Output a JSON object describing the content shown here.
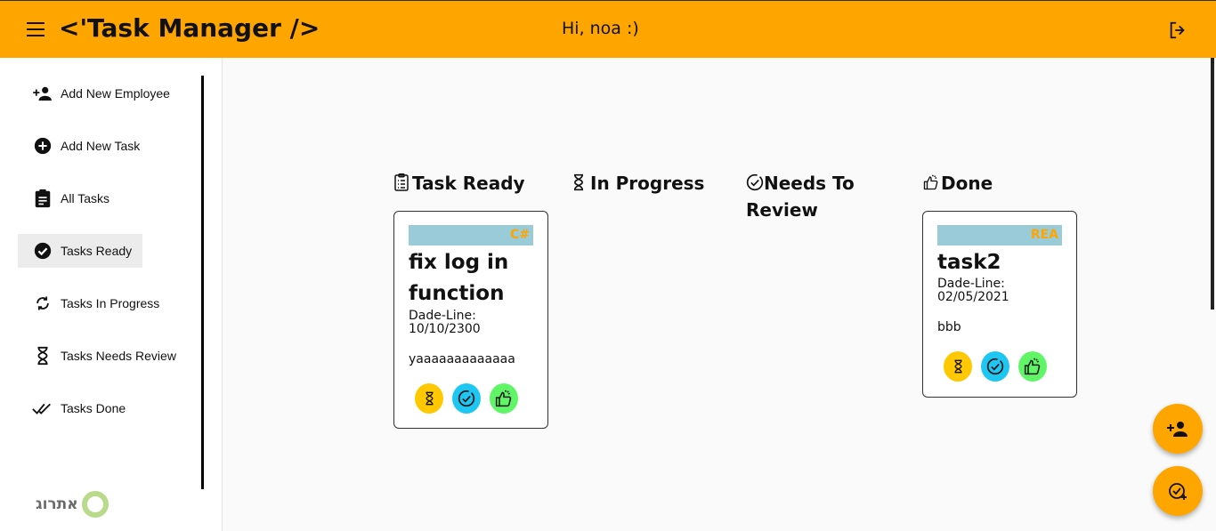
{
  "header": {
    "title": "<'Task Manager />",
    "greeting": "Hi, noa :)",
    "menu_icon": "menu-icon",
    "logout_icon": "logout-icon",
    "background": "#ffa500"
  },
  "sidebar": {
    "items": [
      {
        "label": "Add New Employee",
        "icon": "person-add-icon"
      },
      {
        "label": "Add New Task",
        "icon": "add-circle-icon"
      },
      {
        "label": "All Tasks",
        "icon": "clipboard-icon"
      },
      {
        "label": "Tasks Ready",
        "icon": "check-circle-icon",
        "active": true
      },
      {
        "label": "Tasks In Progress",
        "icon": "sync-icon"
      },
      {
        "label": "Tasks Needs Review",
        "icon": "hourglass-icon"
      },
      {
        "label": "Tasks Done",
        "icon": "double-check-icon"
      }
    ],
    "brand": "אתרוג"
  },
  "columns": [
    {
      "title": "Task Ready",
      "icon": "clipboard-list-icon"
    },
    {
      "title": "In Progress",
      "icon": "hourglass-icon"
    },
    {
      "title": "Needs To Review",
      "icon": "check-circle-outline-icon"
    },
    {
      "title": "Done",
      "icon": "thumbs-up-icon"
    }
  ],
  "cards": [
    {
      "tag": "C#",
      "title": "fix log in function",
      "deadline_label": "Dade-Line:",
      "deadline": "10/10/2300",
      "description": "yaaaaaaaaaaaaa"
    },
    {
      "tag": "REA",
      "title": "task2",
      "deadline_label": "Dade-Line:",
      "deadline": "02/05/2021",
      "description": "bbb"
    }
  ],
  "colors": {
    "accent": "#ffa500",
    "tag_bg": "#9acbd9",
    "action_yellow": "#ffc800",
    "action_blue": "#1ec6f2",
    "action_green": "#5ff567"
  }
}
